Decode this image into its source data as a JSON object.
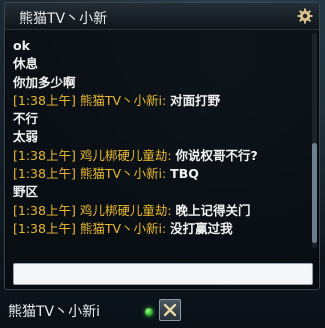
{
  "chat_window": {
    "title": "熊猫TV丶小新",
    "messages": [
      {
        "plain": "ok"
      },
      {
        "plain": "休息"
      },
      {
        "plain": "你加多少啊"
      },
      {
        "time": "[1:38上午]",
        "sender": "熊猫TV丶小新i:",
        "text": "对面打野"
      },
      {
        "plain": "不行"
      },
      {
        "plain": "太弱"
      },
      {
        "time": "[1:38上午]",
        "sender": "鸡儿梆硬儿童劫:",
        "text": "你说权哥不行?"
      },
      {
        "time": "[1:38上午]",
        "sender": "熊猫TV丶小新i:",
        "text": "TBQ"
      },
      {
        "plain": "野区"
      },
      {
        "time": "[1:38上午]",
        "sender": "鸡儿梆硬儿童劫:",
        "text": "晚上记得关门"
      },
      {
        "time": "[1:38上午]",
        "sender": "熊猫TV丶小新i:",
        "text": "没打赢过我"
      }
    ],
    "input": {
      "value": "",
      "placeholder": ""
    }
  },
  "tab_bar": {
    "tab_name": "熊猫TV丶小新i"
  },
  "icons": {
    "settings": "gear-icon",
    "status": "online-status-icon",
    "close": "close-icon"
  },
  "colors": {
    "meta_gold": "#e9b830",
    "message_white": "#f2f2f2",
    "online_green": "#2fae2a"
  }
}
